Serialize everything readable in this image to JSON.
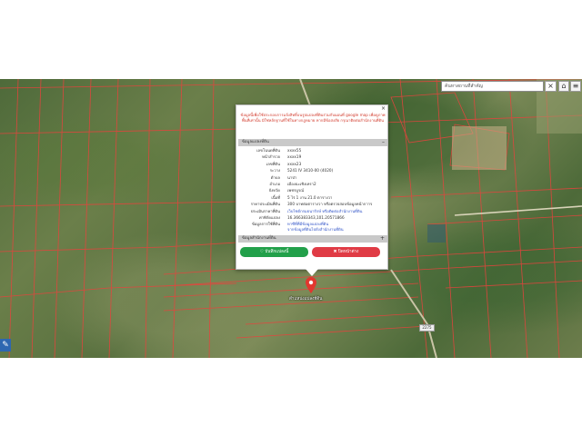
{
  "search": {
    "placeholder": "ค้นหาสถานที่สำคัญ",
    "clear_label": "×"
  },
  "toolbar": {
    "home_icon": "home-icon",
    "layers_icon": "layers-icon"
  },
  "popup": {
    "close_label": "×",
    "notice": "ข้อมูลนี้เพื่อใช้ประกอบการแจ้งสิทธิ์บนรูปแปลงที่ดินร่วมกับแผนที่ google map เพื่อดูภาพพื้นที่เท่านั้น มิใช่หลักฐานที่ใช้ในทางกฎหมาย หากมีข้อสงสัย กรุณาติดต่อสำนักงานที่ดิน",
    "land_section_title": "ข้อมูลแปลงที่ดิน",
    "land_section_toggle": "–",
    "rows": [
      {
        "key": "เลขโฉนดที่ดิน",
        "value": "xxxx55"
      },
      {
        "key": "หน้าสำรวจ",
        "value": "xxxx19"
      },
      {
        "key": "เลขที่ดิน",
        "value": "xxxx23"
      },
      {
        "key": "ระวาง",
        "value": "5241 IV 3410-00 (4020)"
      },
      {
        "key": "ตำบล",
        "value": "นาป่า"
      },
      {
        "key": "อำเภอ",
        "value": "เมืองฉะเชิงเทรา2"
      },
      {
        "key": "จังหวัด",
        "value": "เพชรบูรณ์"
      },
      {
        "key": "เนื้อที่",
        "value": "5 ไร่ 1 งาน 21.0 ตารางวา"
      },
      {
        "key": "ราคาประเมินที่ดิน",
        "value": "300 บาทต่อตารางวา หรือตรวจสอบข้อมูลหน้ากาาร"
      },
      {
        "key": "ประเมินราคาที่ดิน",
        "value": "เว็บไซต์กรมธนารักษ์ หรือติดต่อสำนักงานที่ดิน",
        "link": true
      },
      {
        "key": "ค่าพิกัดแปลง",
        "value": "16.366383343,101.20571866"
      },
      {
        "key": "ข้อมูลการใช้ที่ดิน",
        "value": "หาซีที่ที่มีข้อมูลแปลงที่ดิน",
        "link": true
      }
    ],
    "landuse_link_2": "จากข้อมูลที่ดินไปยังสำนักงานที่ดิน",
    "office_section_title": "ข้อมูลสำนักงานที่ดิน",
    "office_section_toggle": "+",
    "save_label": "♡ บันทึกแปลงนี้",
    "cancel_label": "✖ ปิดหน้าต่าง"
  },
  "marker": {
    "label": "ตำแหน่งแปลงที่ดิน"
  },
  "road_tag": "2275",
  "colors": {
    "parcel_line": "#e8433d",
    "save": "#22a04a",
    "cancel": "#e03b45",
    "notice": "#d23b2d"
  }
}
